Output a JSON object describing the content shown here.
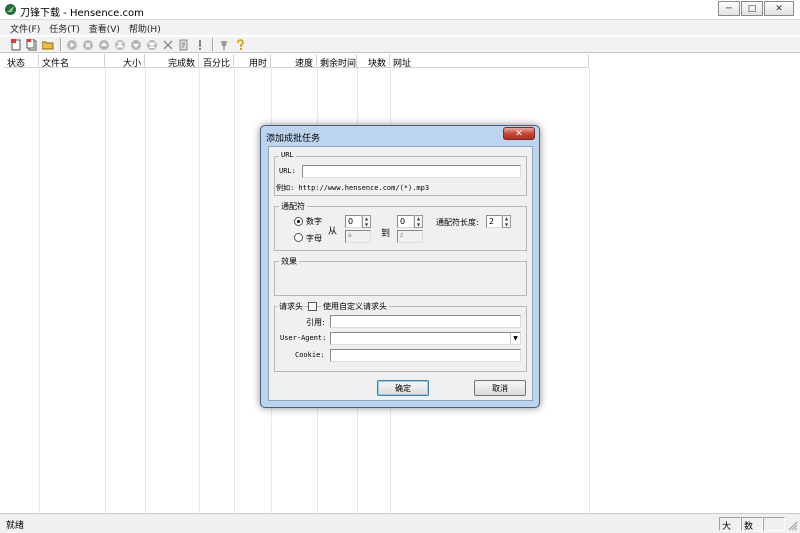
{
  "window": {
    "title": "刀锋下载 - Hensence.com",
    "buttons": {
      "minimize": "─",
      "maximize": "□",
      "close": "✕"
    }
  },
  "menu": [
    "文件(F)",
    "任务(T)",
    "查看(V)",
    "帮助(H)"
  ],
  "toolbar_icons": [
    "new-task-icon",
    "batch-task-icon",
    "open-folder-icon",
    "start-icon",
    "stop-icon",
    "move-up-icon",
    "move-top-icon",
    "move-down-icon",
    "move-bottom-icon",
    "delete-icon",
    "properties-icon",
    "info-icon",
    "pin-icon",
    "help-icon"
  ],
  "list": {
    "columns": [
      "状态",
      "文件名",
      "大小",
      "完成数",
      "百分比",
      "用时",
      "速度",
      "剩余时间",
      "块数",
      "网址"
    ]
  },
  "status": {
    "text": "就绪",
    "caps": "大写",
    "num": "数字",
    "scroll": ""
  },
  "dialog": {
    "title": "添加成批任务",
    "close": "✕",
    "url_group": "URL",
    "url_label": "URL:",
    "url_value": "",
    "example": "例如: http://www.hensence.com/(*).mp3",
    "wildcard_group": "通配符",
    "radio_digit": "数字",
    "radio_letter": "字母",
    "selected": "数字",
    "from_label": "从",
    "to_label": "到",
    "from_digit": "0",
    "to_digit": "0",
    "from_letter": "a",
    "to_letter": "z",
    "length_label": "通配符长度:",
    "length_value": "2",
    "effect_group": "效果",
    "header_group": "请求头",
    "custom_header_label": "使用自定义请求头",
    "custom_header_checked": false,
    "referer_label": "引用:",
    "useragent_label": "User-Agent:",
    "cookie_label": "Cookie:",
    "referer_value": "",
    "useragent_value": "",
    "cookie_value": "",
    "ok": "确定",
    "cancel": "取消"
  }
}
